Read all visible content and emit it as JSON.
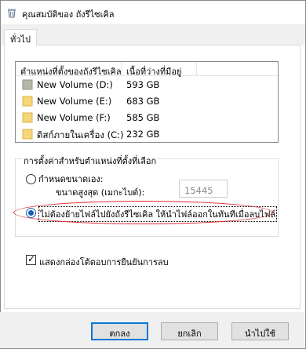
{
  "window": {
    "title": "คุณสมบัติของ ถังรีไซเคิล",
    "icon": "recycle-bin-icon"
  },
  "tabs": [
    {
      "label": "ทั่วไป",
      "active": true
    }
  ],
  "listview": {
    "columns": [
      "ตำแหน่งที่ตั้งของถังรีไซเคิล",
      "เนื้อที่ว่างที่มีอยู่"
    ],
    "rows": [
      {
        "name": "New Volume (D:)",
        "free": "593 GB",
        "selected": true,
        "icon": "drive-icon"
      },
      {
        "name": "New Volume (E:)",
        "free": "683 GB",
        "selected": false,
        "icon": "drive-icon"
      },
      {
        "name": "New Volume (F:)",
        "free": "585 GB",
        "selected": false,
        "icon": "drive-icon"
      },
      {
        "name": "ดิสก์ภายในเครื่อง (C:)",
        "free": "232 GB",
        "selected": false,
        "icon": "drive-icon"
      }
    ]
  },
  "settings": {
    "group_label": "การตั้งค่าสำหรับตำแหน่งที่ตั้งที่เลือก",
    "custom_size_label": "กำหนดขนาดเอง:",
    "max_size_label": "ขนาดสูงสุด (เมกะไบต์):",
    "max_size_value": "15445",
    "no_move_label": "ไม่ต้องย้ายไฟล์ไปยังถังรีไซเคิล ให้นำไฟล์ออกในทันทีเมื่อลบไฟล์",
    "selected_option": "no_move"
  },
  "confirm_delete": {
    "label": "แสดงกล่องโต้ตอบการยืนยันการลบ",
    "checked": true
  },
  "buttons": {
    "ok": "ตกลง",
    "cancel": "ยกเลิก",
    "apply": "นำไปใช้"
  },
  "colors": {
    "accent": "#0078d7",
    "highlight_ellipse": "#e0282e"
  }
}
